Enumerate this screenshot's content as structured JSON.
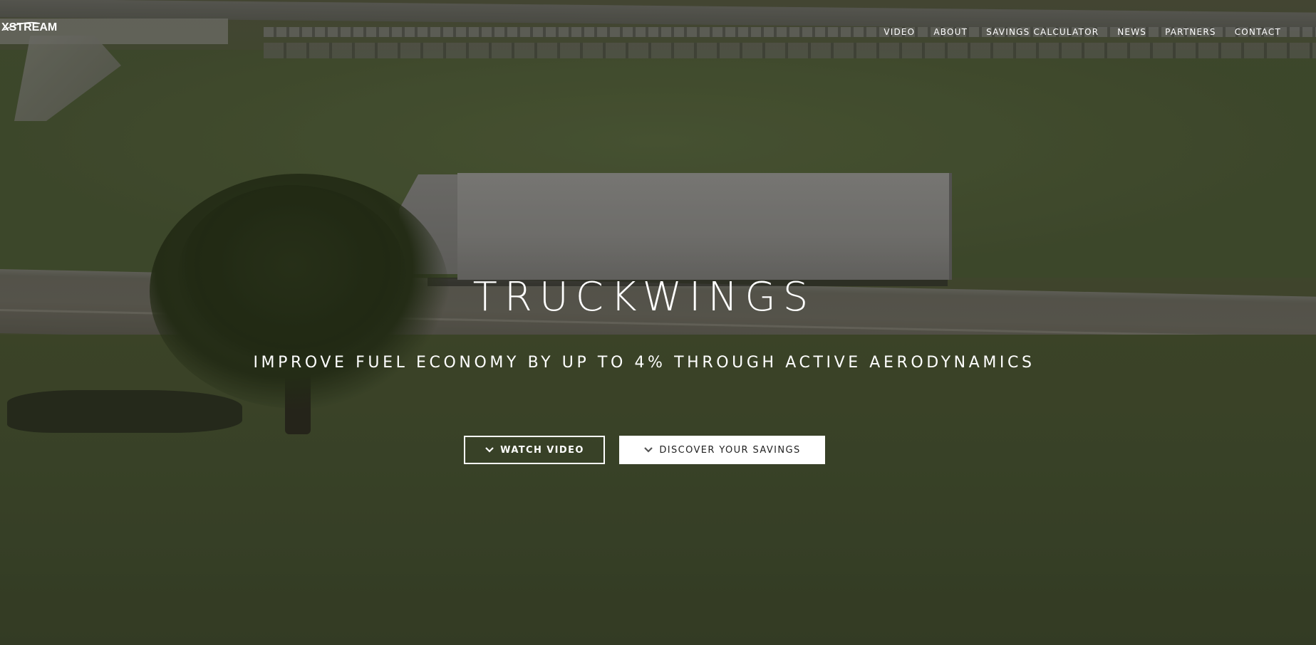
{
  "brand": {
    "logo_text": "XSTREAM"
  },
  "nav": {
    "items": [
      {
        "label": "VIDEO"
      },
      {
        "label": "ABOUT"
      },
      {
        "label": "SAVINGS CALCULATOR"
      },
      {
        "label": "NEWS"
      },
      {
        "label": "PARTNERS"
      },
      {
        "label": "CONTACT"
      }
    ]
  },
  "hero": {
    "title": "TRUCKWINGS",
    "subtitle": "IMPROVE FUEL ECONOMY BY UP TO 4% THROUGH ACTIVE AERODYNAMICS",
    "buttons": {
      "watch_video": {
        "label": "WATCH VIDEO",
        "icon": "chevron-down-icon"
      },
      "discover_savings": {
        "label": "DISCOVER YOUR SAVINGS",
        "icon": "chevron-down-icon"
      }
    }
  },
  "colors": {
    "text": "#ffffff",
    "button_solid_bg": "#ffffff",
    "button_solid_text": "#222222",
    "overlay": "#141412"
  }
}
